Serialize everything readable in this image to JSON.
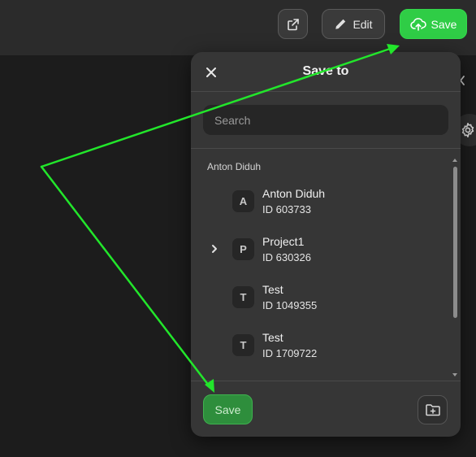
{
  "toolbar": {
    "edit_label": "Edit",
    "save_label": "Save"
  },
  "dialog": {
    "title": "Save to",
    "search_placeholder": "Search",
    "section_label": "Anton Diduh",
    "items": [
      {
        "initial": "A",
        "name": "Anton Diduh",
        "id": "ID 603733",
        "expandable": false
      },
      {
        "initial": "P",
        "name": "Project1",
        "id": "ID 630326",
        "expandable": true
      },
      {
        "initial": "T",
        "name": "Test",
        "id": "ID 1049355",
        "expandable": false
      },
      {
        "initial": "T",
        "name": "Test",
        "id": "ID 1709722",
        "expandable": false
      }
    ],
    "footer_save_label": "Save"
  },
  "icons": {
    "external_link": "external-link-icon",
    "edit": "pencil-icon",
    "save": "cloud-upload-icon",
    "close": "close-icon",
    "chevron": "chevron-right-icon",
    "new_folder": "folder-plus-icon",
    "settings": "gear-icon"
  },
  "colors": {
    "accent_green": "#2fcd46",
    "footer_save_green": "#2e8e3c",
    "annotation_green": "#22e62b",
    "panel_bg": "#363636",
    "topbar_bg": "#2b2b2b",
    "page_bg": "#1c1c1c"
  }
}
